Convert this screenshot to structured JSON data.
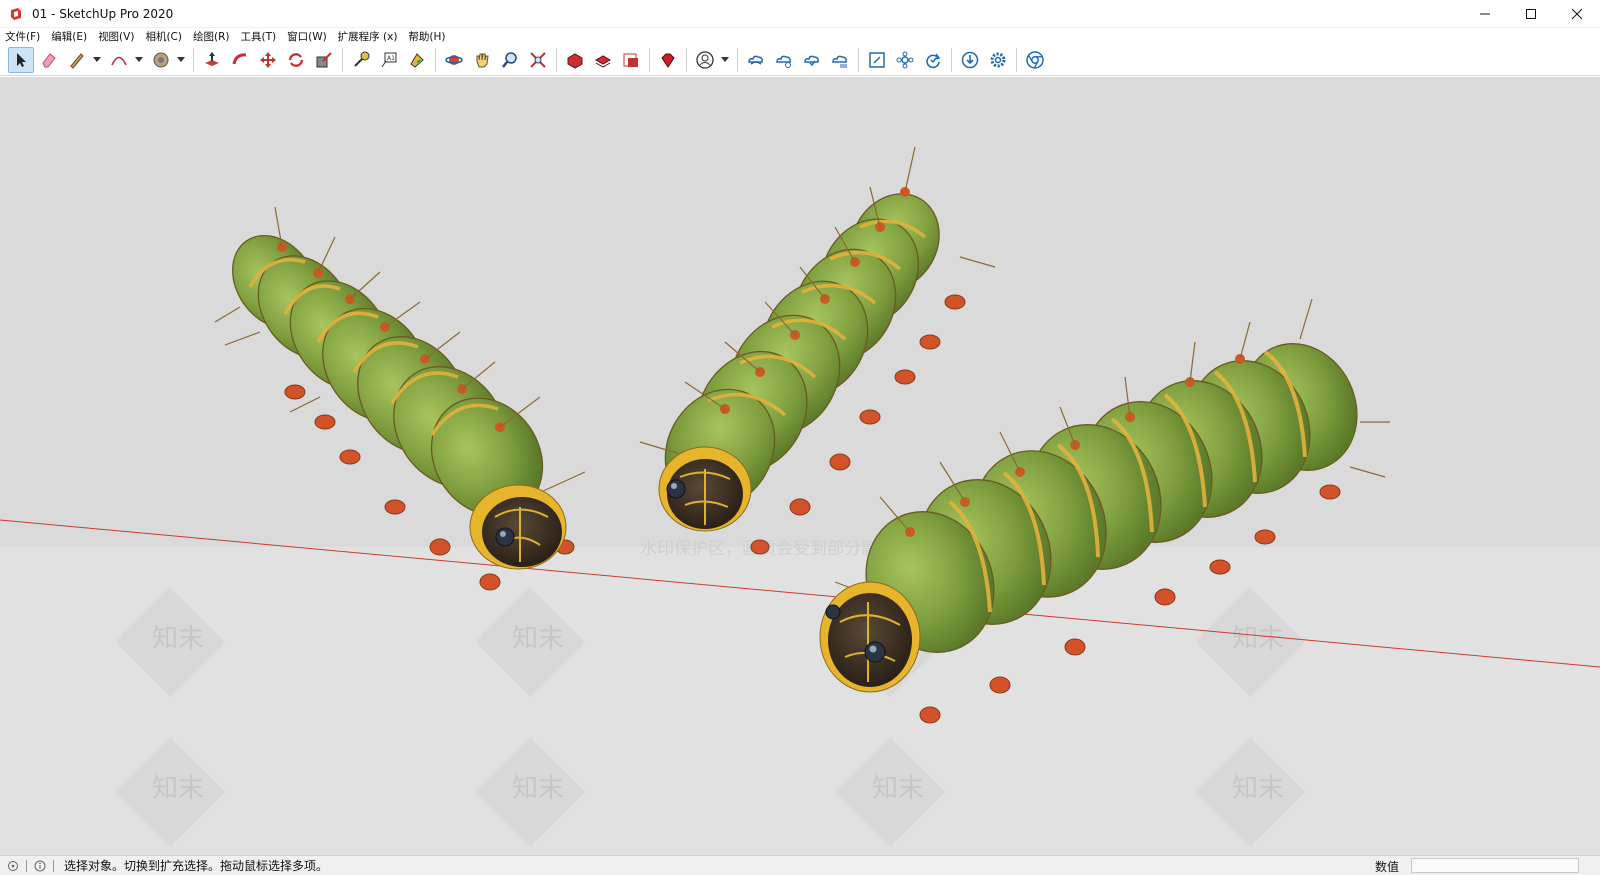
{
  "window": {
    "title": "01 - SketchUp Pro 2020"
  },
  "menu": {
    "items": [
      "文件(F)",
      "编辑(E)",
      "视图(V)",
      "相机(C)",
      "绘图(R)",
      "工具(T)",
      "窗口(W)",
      "扩展程序 (x)",
      "帮助(H)"
    ]
  },
  "toolbar": {
    "tools": [
      "select-icon",
      "eraser-icon",
      "pencil-line-icon",
      "arc-icon",
      "paint-bucket-icon",
      "push-pull-icon",
      "follow-me-icon",
      "move-icon",
      "rotate-icon",
      "scale-icon",
      "tape-measure-icon",
      "text-icon",
      "paint-icon",
      "orbit-icon",
      "pan-icon",
      "zoom-icon",
      "zoom-extents-icon",
      "warehouse-icon",
      "extension-warehouse-icon",
      "layout-icon",
      "ruby-icon",
      "account-icon",
      "cloud-icon",
      "trimble-connect-icon",
      "sync-icon",
      "upload-icon",
      "fit-icon",
      "components-icon",
      "refresh-icon",
      "download-icon",
      "settings-icon",
      "chrome-icon"
    ]
  },
  "viewport": {
    "watermark_text": "知末",
    "watermark_notice": "水印保护区，画质会受到部分影响",
    "axis_color": "#cc3a2e",
    "background_color": "#dadada"
  },
  "status": {
    "message": "选择对象。切换到扩充选择。拖动鼠标选择多项。",
    "measurements_label": "数值",
    "measurements_value": ""
  }
}
